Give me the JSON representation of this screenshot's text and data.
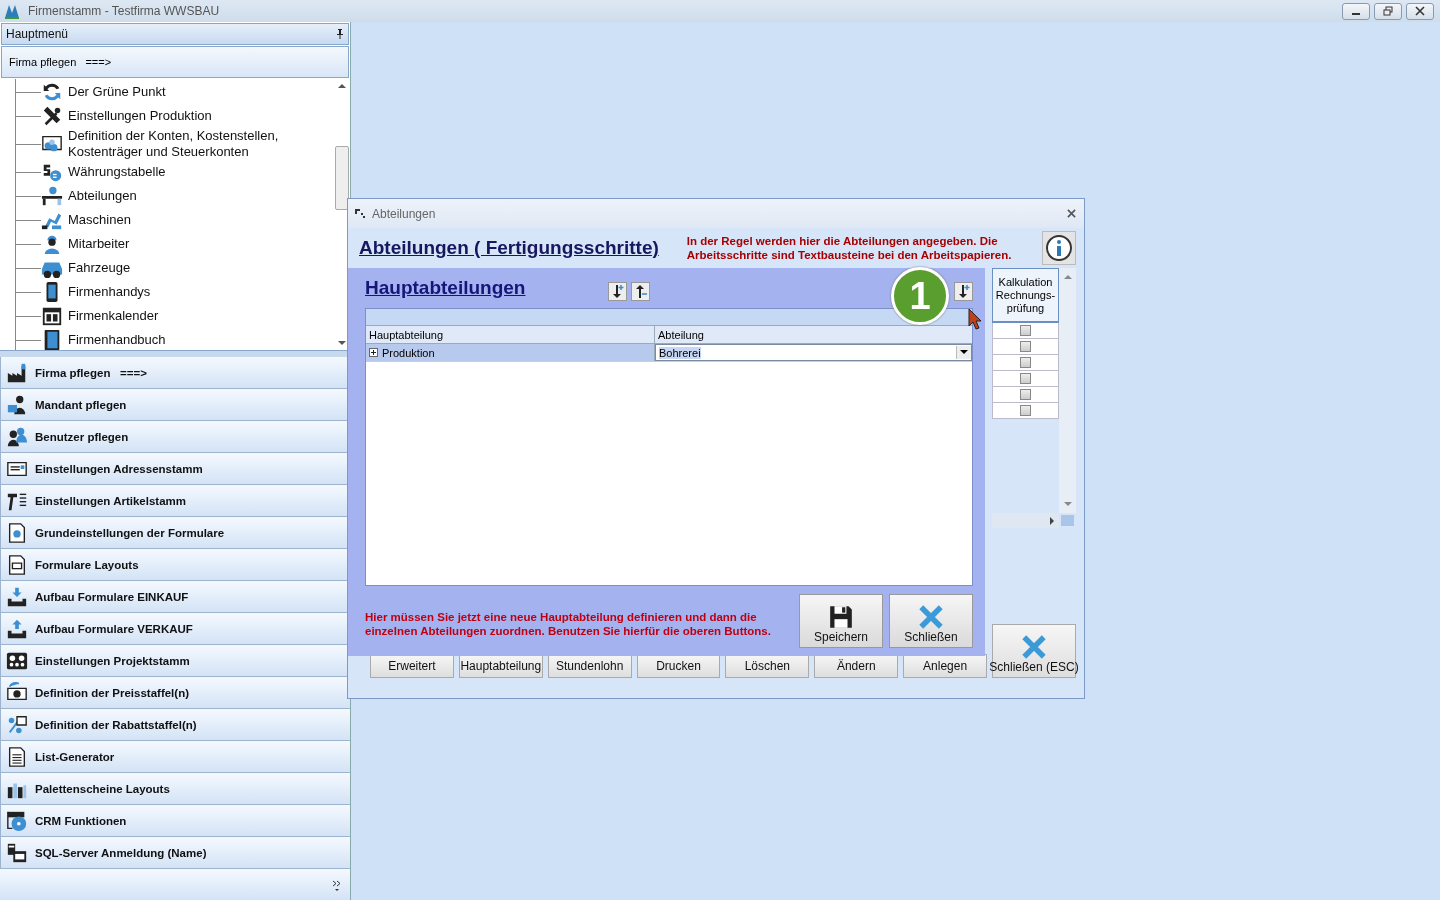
{
  "window": {
    "title": "Firmenstamm - Testfirma WWSBAU"
  },
  "main_menu": {
    "title": "Hauptmenü",
    "section": "Firma pflegen   ===>",
    "tree_items": [
      {
        "label": "Der Grüne Punkt"
      },
      {
        "label": "Einstellungen Produktion"
      },
      {
        "label": "Definition der Konten, Kostenstellen, Kostenträger und Steuerkonten"
      },
      {
        "label": "Währungstabelle"
      },
      {
        "label": "Abteilungen"
      },
      {
        "label": "Maschinen"
      },
      {
        "label": "Mitarbeiter"
      },
      {
        "label": "Fahrzeuge"
      },
      {
        "label": "Firmenhandys"
      },
      {
        "label": "Firmenkalender"
      },
      {
        "label": "Firmenhandbuch"
      }
    ],
    "nav_items": [
      {
        "label": "Firma pflegen   ===>"
      },
      {
        "label": "Mandant pflegen"
      },
      {
        "label": "Benutzer pflegen"
      },
      {
        "label": "Einstellungen Adressenstamm"
      },
      {
        "label": "Einstellungen Artikelstamm"
      },
      {
        "label": "Grundeinstellungen der Formulare"
      },
      {
        "label": "Formulare Layouts"
      },
      {
        "label": "Aufbau Formulare EINKAUF"
      },
      {
        "label": "Aufbau Formulare VERKAUF"
      },
      {
        "label": "Einstellungen Projektstamm"
      },
      {
        "label": "Definition der Preisstaffel(n)"
      },
      {
        "label": "Definition der Rabattstaffel(n)"
      },
      {
        "label": "List-Generator"
      },
      {
        "label": "Palettenscheine Layouts"
      },
      {
        "label": "CRM Funktionen"
      },
      {
        "label": "SQL-Server Anmeldung (Name)"
      }
    ]
  },
  "dialog": {
    "title": "Abteilungen",
    "heading": "Abteilungen ( Fertigungsschritte)",
    "hint": "In der Regel werden hier die Abteilungen angegeben. Die Arbeitsschritte sind Textbausteine bei den Arbeitspapieren.",
    "grid": {
      "column": "Kalkulation Rechnungs-prüfung",
      "rows": [
        {
          "checked": false
        },
        {
          "checked": false
        },
        {
          "checked": false
        },
        {
          "checked": false
        },
        {
          "checked": false
        },
        {
          "checked": false
        }
      ]
    },
    "buttons": [
      "Erweitert",
      "Hauptabteilung",
      "Stundenlohn",
      "Drucken",
      "Löschen",
      "Ändern",
      "Anlegen"
    ],
    "close_button": "Schließen (ESC)"
  },
  "sub_dialog": {
    "heading": "Hauptabteilungen",
    "step_badge": "1",
    "columns": [
      "Hauptabteilung",
      "Abteilung"
    ],
    "rows": [
      {
        "main": "Produktion",
        "department": "Bohrerei",
        "expanded": false,
        "selected": true
      }
    ],
    "hint": "Hier müssen Sie jetzt eine neue Hauptabteilung definieren und dann die einzelnen Abteilungen zuordnen. Benutzen Sie hierfür die oberen Buttons.",
    "save_button": "Speichern",
    "close_button": "Schließen"
  }
}
